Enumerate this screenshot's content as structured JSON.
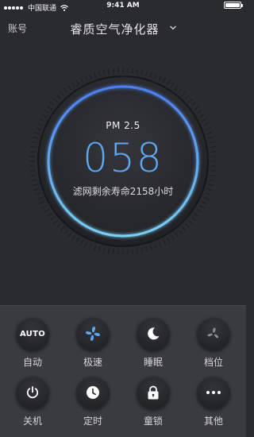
{
  "status_bar": {
    "carrier": "中国联通",
    "time": "9:41 AM"
  },
  "nav": {
    "account_label": "账号",
    "title": "睿质空气净化器"
  },
  "dial": {
    "label": "PM 2.5",
    "value": "058",
    "filter_life": "滤网剩余寿命2158小时",
    "accent_color": "#5fa6f0"
  },
  "controls": [
    {
      "label": "自动",
      "icon_text": "AUTO",
      "icon": "auto-icon"
    },
    {
      "label": "极速",
      "icon": "fan-turbo-icon"
    },
    {
      "label": "睡眠",
      "icon": "moon-icon"
    },
    {
      "label": "档位",
      "icon": "fan-speed-icon"
    },
    {
      "label": "关机",
      "icon": "power-icon"
    },
    {
      "label": "定时",
      "icon": "clock-icon"
    },
    {
      "label": "童锁",
      "icon": "lock-icon"
    },
    {
      "label": "其他",
      "icon": "more-icon"
    }
  ]
}
